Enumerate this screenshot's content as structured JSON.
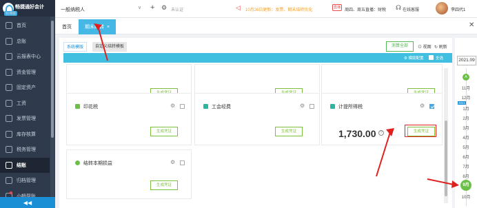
{
  "sidebar": {
    "logo_text": "畅捷通好会计",
    "logo_sub": "标准版",
    "items": [
      {
        "label": "首页"
      },
      {
        "label": "总账"
      },
      {
        "label": "云报表中心"
      },
      {
        "label": "资金管理"
      },
      {
        "label": "固定资产"
      },
      {
        "label": "工资"
      },
      {
        "label": "发票管理"
      },
      {
        "label": "库存核算"
      },
      {
        "label": "税务管理"
      },
      {
        "label": "结账"
      },
      {
        "label": "归档管理"
      },
      {
        "label": "小畅帮账"
      }
    ],
    "bottom_icon": "double-arrow-left"
  },
  "topbar": {
    "company": "一般纳税人",
    "unverified": "未认证",
    "notice": "10月26日更新：发票、期末结转优化",
    "live_badge": "直播",
    "live_text": "周四、周五直播：财税",
    "service": "在线客服",
    "user": "李四代1"
  },
  "tabs": {
    "home": "首页",
    "active": "期末结转",
    "close_glyph": "×"
  },
  "panel": {
    "subtab1": "系统模版",
    "subtab2": "自定义结转模板",
    "generate_all": "测算全部",
    "view_mode": "视图",
    "refresh": "刷新",
    "template_cfg": "模版配置",
    "select_all": "全选"
  },
  "cards": [
    {
      "title": "",
      "button": "生成凭证"
    },
    {
      "title": "",
      "button": "生成凭证"
    },
    {
      "title": "",
      "button": "生成凭证"
    },
    {
      "title": "印花税",
      "button": "生成凭证",
      "checked": false,
      "icon_color": "#6cc04a"
    },
    {
      "title": "工会经费",
      "button": "生成凭证",
      "checked": false,
      "icon_color": "#2bb5a0"
    },
    {
      "title": "计提所得税",
      "button": "生成凭证",
      "checked": true,
      "amount": "1,730.00",
      "icon_color": "#2bb5a0"
    },
    {
      "title": "结转本期损益",
      "button": "生成凭证",
      "checked": false,
      "icon_color": "#6cc04a"
    }
  ],
  "timeline": {
    "year": "2021.09",
    "months": [
      "11月",
      "12月",
      "1月",
      "2月",
      "3月",
      "4月",
      "5月",
      "6月",
      "7月",
      "8月",
      "10月"
    ],
    "year_badge": "2021",
    "top_dot": "A",
    "current_month": "9月"
  }
}
